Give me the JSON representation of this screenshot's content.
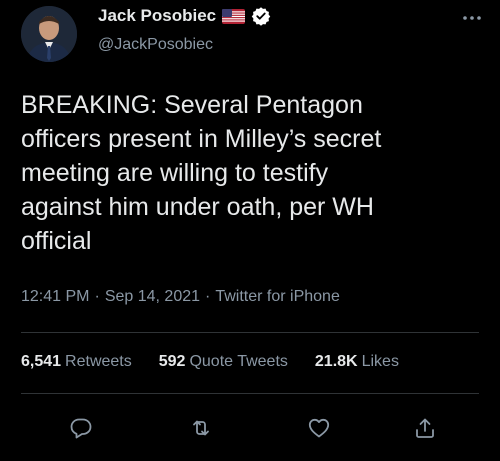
{
  "author": {
    "display_name": "Jack Posobiec",
    "handle": "@JackPosobiec",
    "flag_icon": "us-flag-icon",
    "verified_icon": "verified-badge-icon"
  },
  "tweet": {
    "lines": [
      "BREAKING: Several Pentagon",
      "officers present in Milley’s secret",
      "meeting are willing to testify",
      "against him under oath, per WH",
      "official"
    ]
  },
  "meta": {
    "time": "12:41 PM",
    "date": "Sep 14, 2021",
    "source": "Twitter for iPhone",
    "separator": "·"
  },
  "stats": {
    "retweets": {
      "count": "6,541",
      "label": "Retweets"
    },
    "quotes": {
      "count": "592",
      "label": "Quote Tweets"
    },
    "likes": {
      "count": "21.8K",
      "label": "Likes"
    }
  },
  "actions": {
    "reply_icon": "reply-icon",
    "retweet_icon": "retweet-icon",
    "like_icon": "heart-icon",
    "share_icon": "share-icon"
  },
  "colors": {
    "background": "#000000",
    "primary_text": "#e7e9ea",
    "secondary_text": "#8b98a5",
    "verified": "#ffffff",
    "divider": "#2f3336"
  }
}
